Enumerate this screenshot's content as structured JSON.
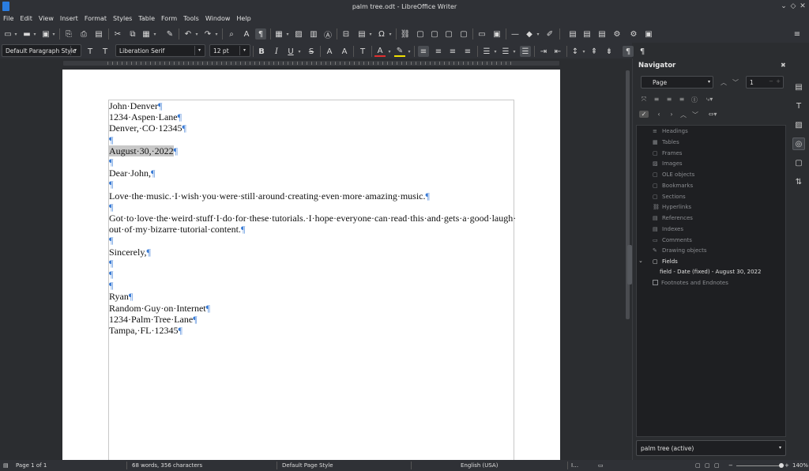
{
  "window": {
    "title": "palm tree.odt - LibreOffice Writer"
  },
  "menu": [
    "File",
    "Edit",
    "View",
    "Insert",
    "Format",
    "Styles",
    "Table",
    "Form",
    "Tools",
    "Window",
    "Help"
  ],
  "formatting": {
    "paragraph_style": "Default Paragraph Style",
    "font_name": "Liberation Serif",
    "font_size": "12 pt"
  },
  "document": {
    "lines": [
      {
        "text": "John·Denver",
        "mark": "¶",
        "highlight": false
      },
      {
        "text": "1234·Aspen·Lane",
        "mark": "¶",
        "highlight": false
      },
      {
        "text": "Denver,·CO·12345",
        "mark": "¶",
        "highlight": false
      },
      {
        "text": "",
        "mark": "¶",
        "highlight": false
      },
      {
        "text": "August·30,·2022",
        "mark": "¶",
        "highlight": true
      },
      {
        "text": "",
        "mark": "¶",
        "highlight": false
      },
      {
        "text": "Dear·John,",
        "mark": "¶",
        "highlight": false
      },
      {
        "text": "",
        "mark": "¶",
        "highlight": false
      },
      {
        "text": "Love·the·music.·I·wish·you·were·still·around·creating·even·more·amazing·music.",
        "mark": "¶",
        "highlight": false
      },
      {
        "text": "",
        "mark": "¶",
        "highlight": false
      },
      {
        "text": "Got·to·love·the·weird·stuff·I·do·for·these·tutorials.·I·hope·everyone·can·read·this·and·gets·a·good·laugh·",
        "mark": "",
        "highlight": false
      },
      {
        "text": "out·of·my·bizarre·tutorial·content.",
        "mark": "¶",
        "highlight": false
      },
      {
        "text": "",
        "mark": "¶",
        "highlight": false
      },
      {
        "text": "Sincerely,",
        "mark": "¶",
        "highlight": false
      },
      {
        "text": "",
        "mark": "¶",
        "highlight": false
      },
      {
        "text": "",
        "mark": "¶",
        "highlight": false
      },
      {
        "text": "",
        "mark": "¶",
        "highlight": false
      },
      {
        "text": "Ryan",
        "mark": "¶",
        "highlight": false
      },
      {
        "text": "Random·Guy·on·Internet",
        "mark": "¶",
        "highlight": false
      },
      {
        "text": "1234·Palm·Tree·Lane",
        "mark": "¶",
        "highlight": false
      },
      {
        "text": "Tampa,·FL·12345",
        "mark": "¶",
        "highlight": false
      }
    ]
  },
  "navigator": {
    "title": "Navigator",
    "navigate_by": "Page",
    "page_number": "1",
    "categories": [
      {
        "label": "Headings",
        "active": false
      },
      {
        "label": "Tables",
        "active": false
      },
      {
        "label": "Frames",
        "active": false
      },
      {
        "label": "Images",
        "active": false
      },
      {
        "label": "OLE objects",
        "active": false
      },
      {
        "label": "Bookmarks",
        "active": false
      },
      {
        "label": "Sections",
        "active": false
      },
      {
        "label": "Hyperlinks",
        "active": false
      },
      {
        "label": "References",
        "active": false
      },
      {
        "label": "Indexes",
        "active": false
      },
      {
        "label": "Comments",
        "active": false
      },
      {
        "label": "Drawing objects",
        "active": false
      },
      {
        "label": "Fields",
        "active": true
      }
    ],
    "field_child": "field - Date (fixed) - August 30, 2022",
    "last_category": "Footnotes and Endnotes",
    "document_select": "palm tree (active)"
  },
  "statusbar": {
    "page": "Page 1 of 1",
    "words": "68 words, 356 characters",
    "page_style": "Default Page Style",
    "language": "English (USA)",
    "zoom": "140%"
  },
  "colors": {
    "accent": "#3a7bd5",
    "font_color": "#e03030",
    "highlight_color": "#f0e000"
  }
}
